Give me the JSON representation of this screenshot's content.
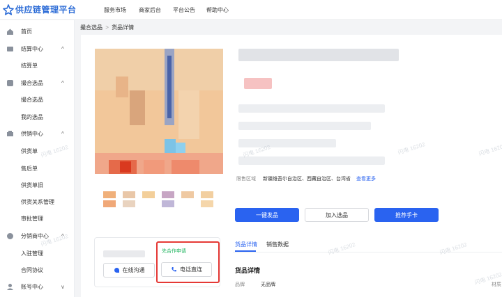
{
  "app": {
    "title": "供应链管理平台"
  },
  "topnav": [
    "服务市场",
    "商家后台",
    "平台公告",
    "帮助中心"
  ],
  "sidebar": {
    "items": [
      {
        "label": "首页",
        "icon": "home-icon",
        "group": false
      },
      {
        "label": "结算中心",
        "icon": "settlement-icon",
        "group": true,
        "chevron": "^"
      },
      {
        "label": "结算单",
        "group": false
      },
      {
        "label": "撮合选品",
        "icon": "match-icon",
        "group": true,
        "chevron": "^"
      },
      {
        "label": "撮合选品",
        "group": false
      },
      {
        "label": "我的选品",
        "group": false
      },
      {
        "label": "供销中心",
        "icon": "supply-icon",
        "group": true,
        "chevron": "^"
      },
      {
        "label": "供货单",
        "group": false
      },
      {
        "label": "售后单",
        "group": false
      },
      {
        "label": "供货单旧",
        "group": false
      },
      {
        "label": "供货关系管理",
        "group": false
      },
      {
        "label": "审批管理",
        "group": false
      },
      {
        "label": "分销商中心",
        "icon": "distributor-icon",
        "group": true,
        "chevron": "^"
      },
      {
        "label": "入驻管理",
        "group": false
      },
      {
        "label": "合同协议",
        "group": false
      },
      {
        "label": "账号中心",
        "icon": "account-icon",
        "group": true,
        "chevron": "v"
      }
    ]
  },
  "breadcrumb": {
    "parent": "撮合选品",
    "separator": ">",
    "current": "货品详情"
  },
  "contact": {
    "tag": "先合作申请",
    "online_button": "在线沟通",
    "phone_button": "电话直连"
  },
  "sales": {
    "label": "限售区域",
    "regions": "新疆维吾尔自治区、西藏自治区、台湾省",
    "more_link": "查看更多"
  },
  "actions": {
    "publish": "一键发品",
    "add": "加入选品",
    "recommend": "推荐手卡"
  },
  "tabs": [
    "货品详情",
    "销售数据"
  ],
  "detail": {
    "section_title": "货品详情",
    "brand_label": "品牌",
    "brand_value": "无品牌",
    "material_label": "材质"
  },
  "watermark": "闪电 16202",
  "colors": {
    "primary": "#2a63f0",
    "brand": "#2b6bd6",
    "highlight_box": "#e53935",
    "tag_green": "#19b35b"
  }
}
